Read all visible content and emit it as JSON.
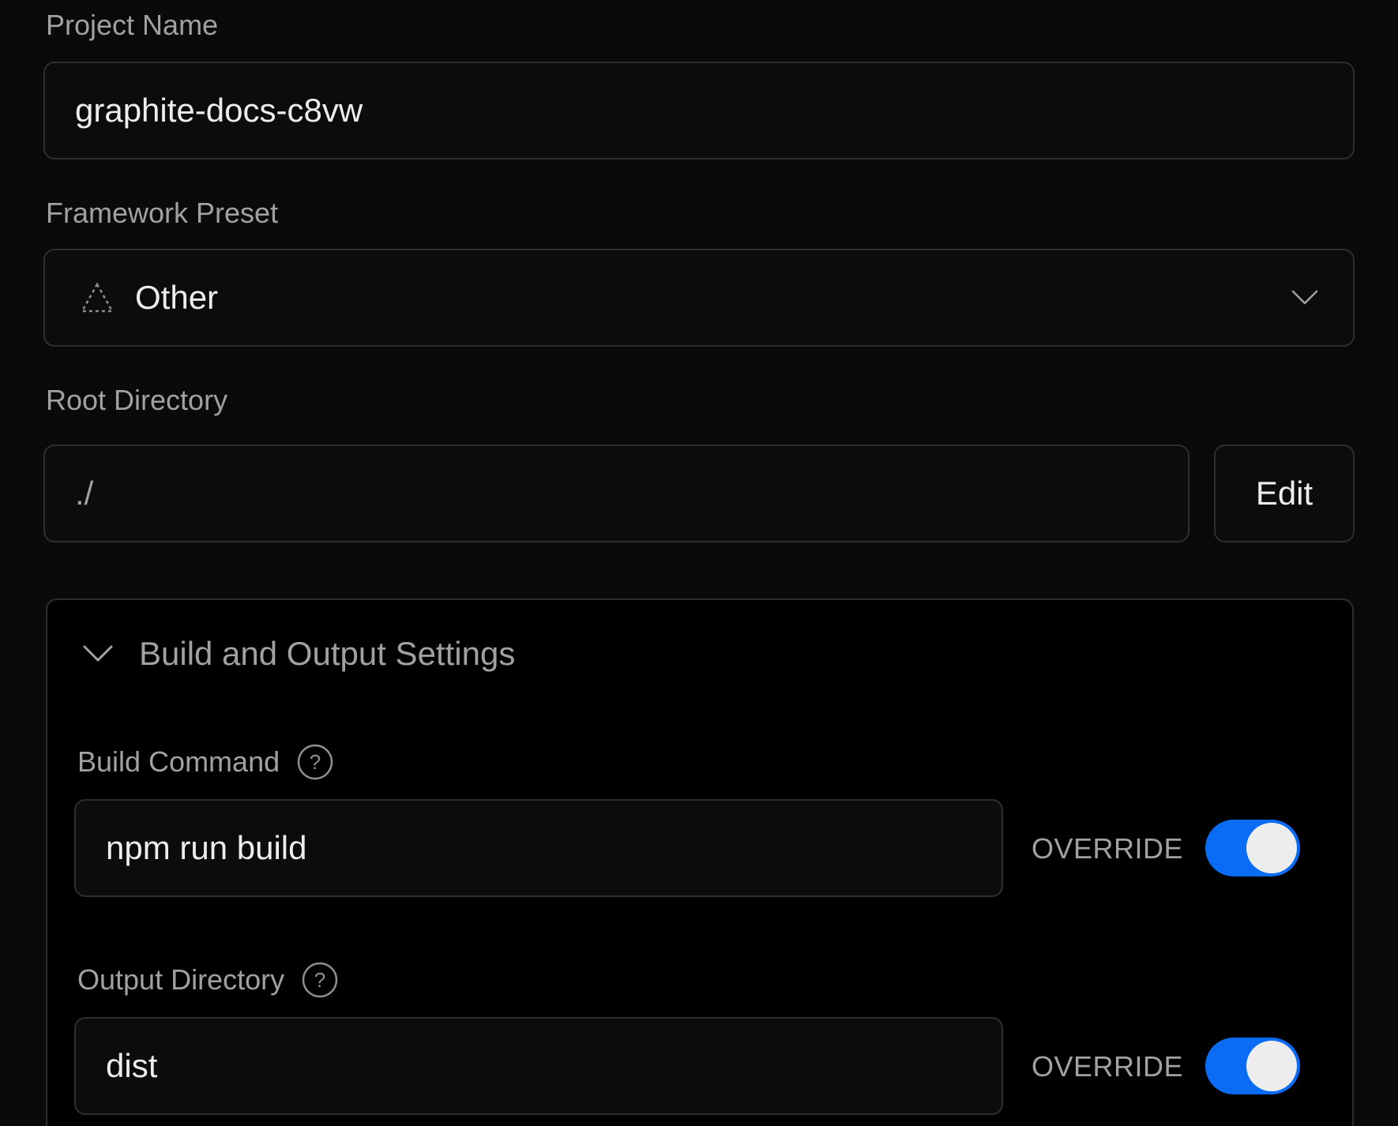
{
  "project_name": {
    "label": "Project Name",
    "value": "graphite-docs-c8vw"
  },
  "framework_preset": {
    "label": "Framework Preset",
    "selected": "Other",
    "icon": "dashed-triangle-icon",
    "dropdown_icon": "chevron-down-icon"
  },
  "root_directory": {
    "label": "Root Directory",
    "value": "./",
    "edit_label": "Edit"
  },
  "build_output": {
    "title": "Build and Output Settings",
    "expanded": true,
    "build_command": {
      "label": "Build Command",
      "value": "npm run build",
      "override_label": "OVERRIDE",
      "override_on": true
    },
    "output_directory": {
      "label": "Output Directory",
      "value": "dist",
      "override_label": "OVERRIDE",
      "override_on": true
    }
  },
  "colors": {
    "background": "#0a0a0a",
    "border": "#2e2e2e",
    "toggle_on": "#0a6cf5"
  }
}
